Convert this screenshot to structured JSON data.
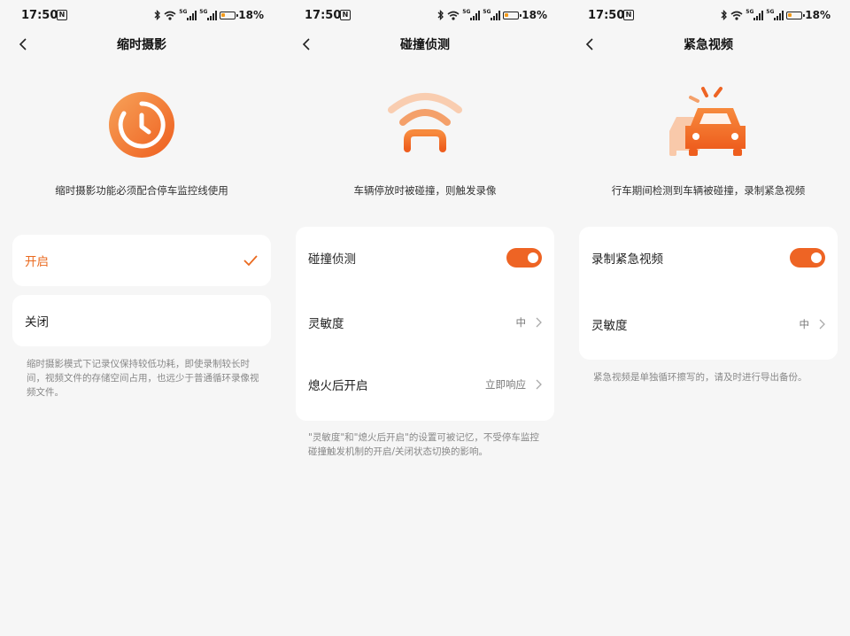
{
  "status": {
    "time": "17:50",
    "nfc": "N",
    "network": "5G",
    "battery_text": "18%",
    "battery_level": 0.18
  },
  "screens": [
    {
      "title": "缩时摄影",
      "hero_icon": "timer-icon",
      "description": "缩时摄影功能必须配合停车监控线使用",
      "options": [
        {
          "label": "开启",
          "selected": true
        },
        {
          "label": "关闭",
          "selected": false
        }
      ],
      "note": "缩时摄影模式下记录仪保持较低功耗，即使录制较长时间，视频文件的存储空间占用，也远少于普通循环录像视频文件。"
    },
    {
      "title": "碰撞侦测",
      "hero_icon": "collision-signal-icon",
      "description": "车辆停放时被碰撞，则触发录像",
      "rows": [
        {
          "label": "碰撞侦测",
          "toggle": true
        },
        {
          "label": "灵敏度",
          "value": "中"
        },
        {
          "label": "熄火后开启",
          "value": "立即响应"
        }
      ],
      "note": "\"灵敏度\"和\"熄火后开启\"的设置可被记忆，不受停车监控碰撞触发机制的开启/关闭状态切换的影响。"
    },
    {
      "title": "紧急视频",
      "hero_icon": "car-crash-icon",
      "description": "行车期间检测到车辆被碰撞，录制紧急视频",
      "rows": [
        {
          "label": "录制紧急视频",
          "toggle": true
        },
        {
          "label": "灵敏度",
          "value": "中"
        }
      ],
      "note": "紧急视频是单独循环擦写的，请及时进行导出备份。"
    }
  ],
  "colors": {
    "accent": "#ee6424",
    "accent_light": "#f9b37a",
    "background": "#f6f6f6",
    "card": "#ffffff"
  }
}
